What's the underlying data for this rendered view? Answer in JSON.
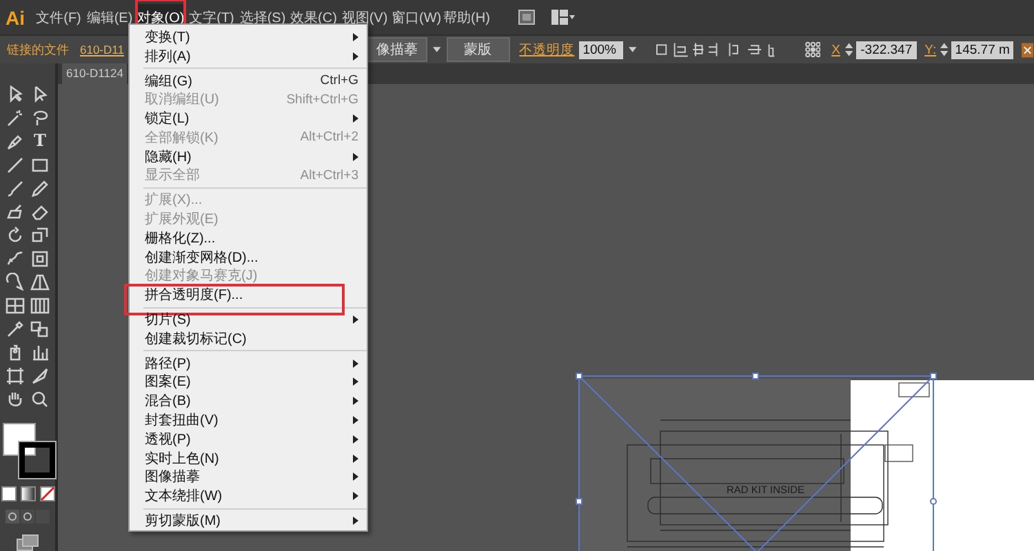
{
  "menubar": {
    "logo": "Ai",
    "menus": [
      {
        "label": "文件(F)",
        "selected": false,
        "highlighted": false
      },
      {
        "label": "编辑(E)",
        "selected": false,
        "highlighted": false
      },
      {
        "label": "对象(O)",
        "selected": true,
        "highlighted": true
      },
      {
        "label": "文字(T)",
        "selected": false,
        "highlighted": false
      },
      {
        "label": "选择(S)",
        "selected": false,
        "highlighted": false
      },
      {
        "label": "效果(C)",
        "selected": false,
        "highlighted": false
      },
      {
        "label": "视图(V)",
        "selected": false,
        "highlighted": false
      },
      {
        "label": "窗口(W)",
        "selected": false,
        "highlighted": false
      },
      {
        "label": "帮助(H)",
        "selected": false,
        "highlighted": false
      }
    ]
  },
  "control_bar": {
    "file_status": "链接的文件",
    "file_link": "610-D11",
    "trace_button": "像描摹",
    "mask_button": "蒙版",
    "opacity_label": "不透明度",
    "opacity_value": "100%",
    "x_label": "X",
    "x_value": "-322.347",
    "y_label": "Y:",
    "y_value": "145.77 m"
  },
  "document_tab": {
    "title": "610-D1124"
  },
  "toolbox": {
    "type_tool_glyph": "T"
  },
  "object_menu": {
    "items": [
      {
        "kind": "item",
        "label": "变换(T)",
        "submenu": true,
        "disabled": false,
        "highlighted": false
      },
      {
        "kind": "item",
        "label": "排列(A)",
        "submenu": true,
        "disabled": false,
        "highlighted": false
      },
      {
        "kind": "separator"
      },
      {
        "kind": "item",
        "label": "编组(G)",
        "shortcut": "Ctrl+G",
        "submenu": false,
        "disabled": false,
        "highlighted": false
      },
      {
        "kind": "item",
        "label": "取消编组(U)",
        "shortcut": "Shift+Ctrl+G",
        "submenu": false,
        "disabled": true,
        "highlighted": false
      },
      {
        "kind": "item",
        "label": "锁定(L)",
        "submenu": true,
        "disabled": false,
        "highlighted": false
      },
      {
        "kind": "item",
        "label": "全部解锁(K)",
        "shortcut": "Alt+Ctrl+2",
        "submenu": false,
        "disabled": true,
        "highlighted": false
      },
      {
        "kind": "item",
        "label": "隐藏(H)",
        "submenu": true,
        "disabled": false,
        "highlighted": false
      },
      {
        "kind": "item",
        "label": "显示全部",
        "shortcut": "Alt+Ctrl+3",
        "submenu": false,
        "disabled": true,
        "highlighted": false
      },
      {
        "kind": "separator"
      },
      {
        "kind": "item",
        "label": "扩展(X)...",
        "submenu": false,
        "disabled": true,
        "highlighted": false
      },
      {
        "kind": "item",
        "label": "扩展外观(E)",
        "submenu": false,
        "disabled": true,
        "highlighted": false
      },
      {
        "kind": "item",
        "label": "栅格化(Z)...",
        "submenu": false,
        "disabled": false,
        "highlighted": false
      },
      {
        "kind": "item",
        "label": "创建渐变网格(D)...",
        "submenu": false,
        "disabled": false,
        "highlighted": false
      },
      {
        "kind": "item",
        "label": "创建对象马赛克(J)",
        "submenu": false,
        "disabled": true,
        "highlighted": false
      },
      {
        "kind": "item",
        "label": "拼合透明度(F)...",
        "submenu": false,
        "disabled": false,
        "highlighted": true
      },
      {
        "kind": "separator"
      },
      {
        "kind": "item",
        "label": "切片(S)",
        "submenu": true,
        "disabled": false,
        "highlighted": false
      },
      {
        "kind": "item",
        "label": "创建裁切标记(C)",
        "submenu": false,
        "disabled": false,
        "highlighted": false
      },
      {
        "kind": "separator"
      },
      {
        "kind": "item",
        "label": "路径(P)",
        "submenu": true,
        "disabled": false,
        "highlighted": false
      },
      {
        "kind": "item",
        "label": "图案(E)",
        "submenu": true,
        "disabled": false,
        "highlighted": false
      },
      {
        "kind": "item",
        "label": "混合(B)",
        "submenu": true,
        "disabled": false,
        "highlighted": false
      },
      {
        "kind": "item",
        "label": "封套扭曲(V)",
        "submenu": true,
        "disabled": false,
        "highlighted": false
      },
      {
        "kind": "item",
        "label": "透视(P)",
        "submenu": true,
        "disabled": false,
        "highlighted": false
      },
      {
        "kind": "item",
        "label": "实时上色(N)",
        "submenu": true,
        "disabled": false,
        "highlighted": false
      },
      {
        "kind": "item",
        "label": "图像描摹",
        "submenu": true,
        "disabled": false,
        "highlighted": false
      },
      {
        "kind": "item",
        "label": "文本绕排(W)",
        "submenu": true,
        "disabled": false,
        "highlighted": false
      },
      {
        "kind": "separator"
      },
      {
        "kind": "item",
        "label": "剪切蒙版(M)",
        "submenu": true,
        "disabled": false,
        "highlighted": false
      }
    ]
  },
  "artwork": {
    "label": "RAD KIT INSIDE"
  }
}
